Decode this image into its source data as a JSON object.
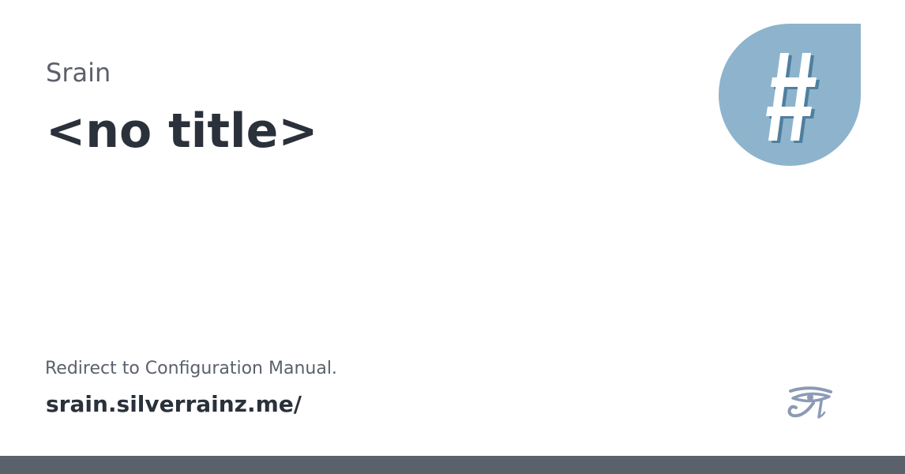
{
  "card": {
    "site_name": "Srain",
    "title": "<no title>",
    "description": "Redirect to Configuration Manual.",
    "url": "srain.silverrainz.me/"
  },
  "logo": {
    "icon": "hash-logo-icon",
    "background_color": "#8db4cc",
    "glyph_color": "#ffffff",
    "shadow_color": "#4f7f9f"
  },
  "footer": {
    "icon": "eye-of-horus-icon",
    "icon_color": "#8c9ab4",
    "bar_color": "#5b616b"
  }
}
